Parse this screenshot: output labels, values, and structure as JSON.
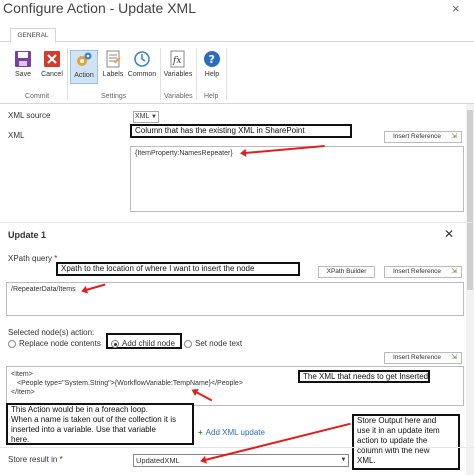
{
  "window": {
    "title": "Configure Action - Update XML",
    "close_glyph": "×"
  },
  "ribbon": {
    "tab": "GENERAL",
    "buttons": {
      "save": "Save",
      "cancel": "Cancel",
      "action": "Action",
      "labels": "Labels",
      "common": "Common",
      "variables": "Variables",
      "help": "Help"
    },
    "groups": {
      "commit": "Commit",
      "settings": "Settings",
      "variables": "Variables",
      "help": "Help"
    }
  },
  "form": {
    "xml_source_label": "XML source",
    "xml_source_value": "XML",
    "xml_label": "XML",
    "insert_reference": "Insert Reference",
    "xml_value": "{ItemProperty:NamesRepeater}",
    "update_header": "Update 1",
    "xpath_label": "XPath query",
    "required_mark": "*",
    "xpath_builder": "XPath Builder",
    "xpath_value": "/RepeaterData/Items",
    "selected_action_label": "Selected node(s) action:",
    "radio_replace": "Replace node contents",
    "radio_add": "Add child node",
    "radio_set": "Set node text",
    "xml_insert_line1": "<Item>",
    "xml_insert_line2": "<People type=\"System.String\">{WorkflowVariable:TempName}</People>",
    "xml_insert_line3": "</Item>",
    "add_xml_update": "Add XML update",
    "store_label": "Store result in",
    "store_value": "UpdatedXML"
  },
  "callouts": {
    "column": "Column that has the existing XML in SharePoint",
    "xpath": "Xpath to the location of where I want to insert the node",
    "xml_insert": "The XML that needs to get Inserted.",
    "foreach_1": "This Action would be in a foreach loop.",
    "foreach_2": "When a name is taken out of the collection it is",
    "foreach_3": "inserted into a variable.  Use that variable",
    "foreach_4": "here.",
    "store_1": "Store Output here and",
    "store_2": "use it in an update item",
    "store_3": "action to update the",
    "store_4": "column with the new",
    "store_5": "XML."
  },
  "colors": {
    "selected_button_bg": "#cfe3f5",
    "arrow": "#e02020",
    "link": "#2a6ebb"
  }
}
